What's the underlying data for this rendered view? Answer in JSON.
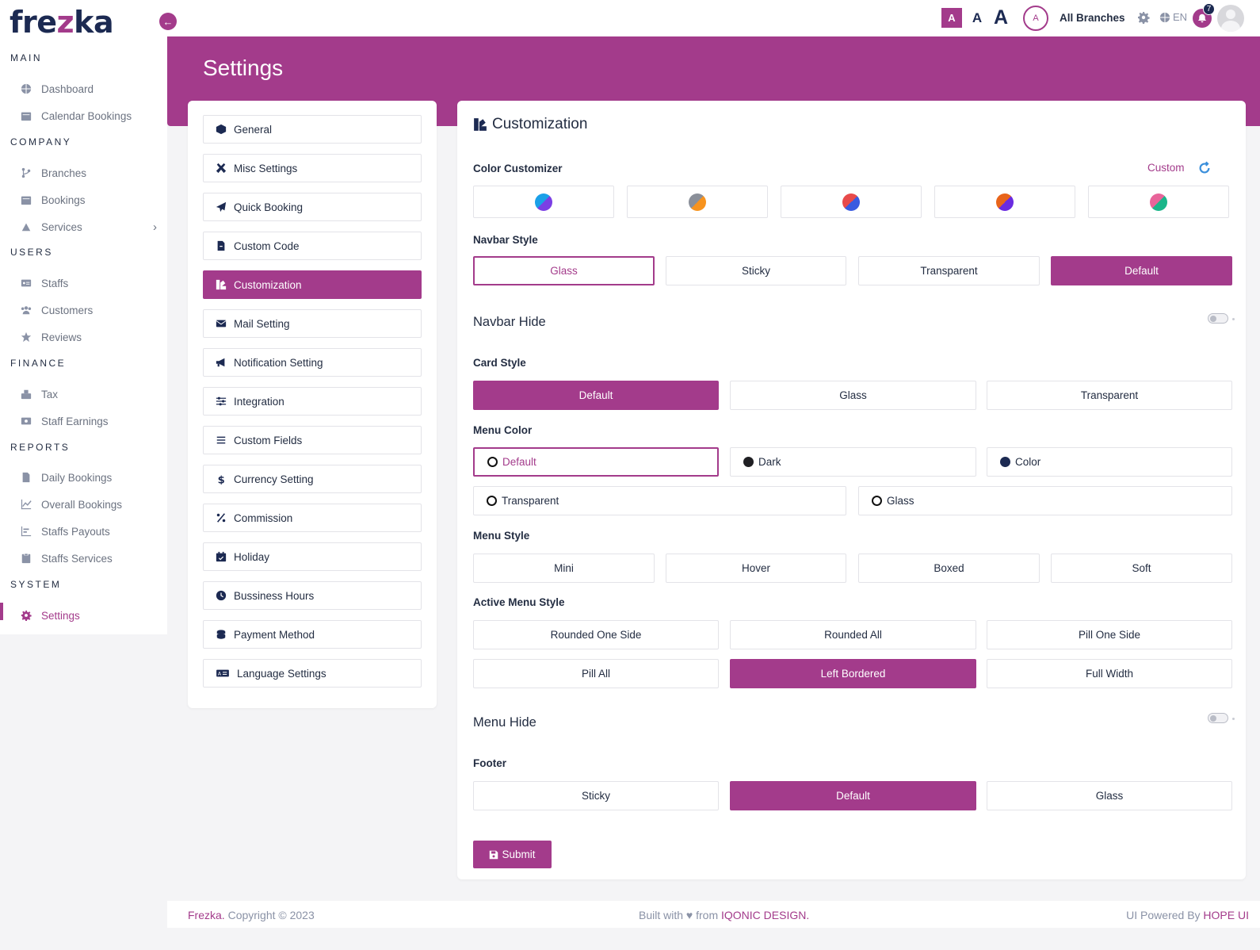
{
  "brand": {
    "logo_pre": "fre",
    "logo_z": "z",
    "logo_post": "ka"
  },
  "sidebar": {
    "sections": [
      {
        "title": "MAIN"
      },
      {
        "title": "COMPANY"
      },
      {
        "title": "USERS"
      },
      {
        "title": "FINANCE"
      },
      {
        "title": "REPORTS"
      },
      {
        "title": "SYSTEM"
      }
    ],
    "items": [
      {
        "label": "Dashboard",
        "icon": "globe-icon"
      },
      {
        "label": "Calendar Bookings",
        "icon": "calendar-icon"
      },
      {
        "label": "Branches",
        "icon": "branch-icon"
      },
      {
        "label": "Bookings",
        "icon": "calendar-icon"
      },
      {
        "label": "Services",
        "icon": "services-icon",
        "chevron": "›"
      },
      {
        "label": "Staffs",
        "icon": "id-card-icon"
      },
      {
        "label": "Customers",
        "icon": "users-icon"
      },
      {
        "label": "Reviews",
        "icon": "star-icon"
      },
      {
        "label": "Tax",
        "icon": "tax-icon"
      },
      {
        "label": "Staff Earnings",
        "icon": "money-icon"
      },
      {
        "label": "Daily Bookings",
        "icon": "file-icon"
      },
      {
        "label": "Overall Bookings",
        "icon": "chart-line-icon"
      },
      {
        "label": "Staffs Payouts",
        "icon": "chart-bar-icon"
      },
      {
        "label": "Staffs Services",
        "icon": "clipboard-icon"
      },
      {
        "label": "Settings",
        "icon": "gear-icon",
        "active": true
      }
    ]
  },
  "topbar": {
    "font_small": "A",
    "font_medium": "A",
    "font_large": "A",
    "branch_avatar": "A",
    "branch_label": "All Branches",
    "language": "EN",
    "notification_count": "7"
  },
  "page": {
    "title": "Settings"
  },
  "settings_menu": [
    {
      "label": "General",
      "icon": "cube-icon"
    },
    {
      "label": "Misc Settings",
      "icon": "tools-icon"
    },
    {
      "label": "Quick Booking",
      "icon": "paper-plane-icon"
    },
    {
      "label": "Custom Code",
      "icon": "file-code-icon"
    },
    {
      "label": "Customization",
      "icon": "palette-icon",
      "active": true
    },
    {
      "label": "Mail Setting",
      "icon": "envelope-icon"
    },
    {
      "label": "Notification Setting",
      "icon": "megaphone-icon"
    },
    {
      "label": "Integration",
      "icon": "sliders-icon"
    },
    {
      "label": "Custom Fields",
      "icon": "list-icon"
    },
    {
      "label": "Currency Setting",
      "icon": "dollar-icon"
    },
    {
      "label": "Commission",
      "icon": "percent-icon"
    },
    {
      "label": "Holiday",
      "icon": "calendar-check-icon"
    },
    {
      "label": "Bussiness Hours",
      "icon": "clock-icon"
    },
    {
      "label": "Payment Method",
      "icon": "coins-icon"
    },
    {
      "label": "Language Settings",
      "icon": "language-icon"
    }
  ],
  "customization": {
    "title": "Customization",
    "color_customizer": {
      "label": "Color Customizer",
      "custom_label": "Custom",
      "swatches": [
        {
          "a": "#1aa0e8",
          "b": "#7b3fe4"
        },
        {
          "a": "#8a8f99",
          "b": "#f7931e"
        },
        {
          "a": "#3a5be0",
          "b": "#e84a4a"
        },
        {
          "a": "#e8641a",
          "b": "#6a2be0"
        },
        {
          "a": "#e8649a",
          "b": "#1ab68a"
        }
      ]
    },
    "navbar_style": {
      "label": "Navbar Style",
      "options": [
        "Glass",
        "Sticky",
        "Transparent",
        "Default"
      ]
    },
    "navbar_hide": {
      "label": "Navbar Hide"
    },
    "card_style": {
      "label": "Card Style",
      "options": [
        "Default",
        "Glass",
        "Transparent"
      ]
    },
    "menu_color": {
      "label": "Menu Color",
      "options": [
        "Default",
        "Dark",
        "Color",
        "Transparent",
        "Glass"
      ]
    },
    "menu_style": {
      "label": "Menu Style",
      "options": [
        "Mini",
        "Hover",
        "Boxed",
        "Soft"
      ]
    },
    "active_menu_style": {
      "label": "Active Menu Style",
      "options": [
        "Rounded One Side",
        "Rounded All",
        "Pill One Side",
        "Pill All",
        "Left Bordered",
        "Full Width"
      ]
    },
    "menu_hide": {
      "label": "Menu Hide"
    },
    "footer_style": {
      "label": "Footer",
      "options": [
        "Sticky",
        "Default",
        "Glass"
      ]
    },
    "submit_label": "Submit"
  },
  "footer": {
    "brand": "Frezka.",
    "copyright": " Copyright © 2023",
    "built_with": "Built with ♥ from ",
    "built_by": "IQONIC DESIGN.",
    "powered": "UI Powered By ",
    "powered_by": "HOPE UI"
  },
  "colors": {
    "accent": "#a33b8b",
    "navy": "#1c2a52"
  }
}
